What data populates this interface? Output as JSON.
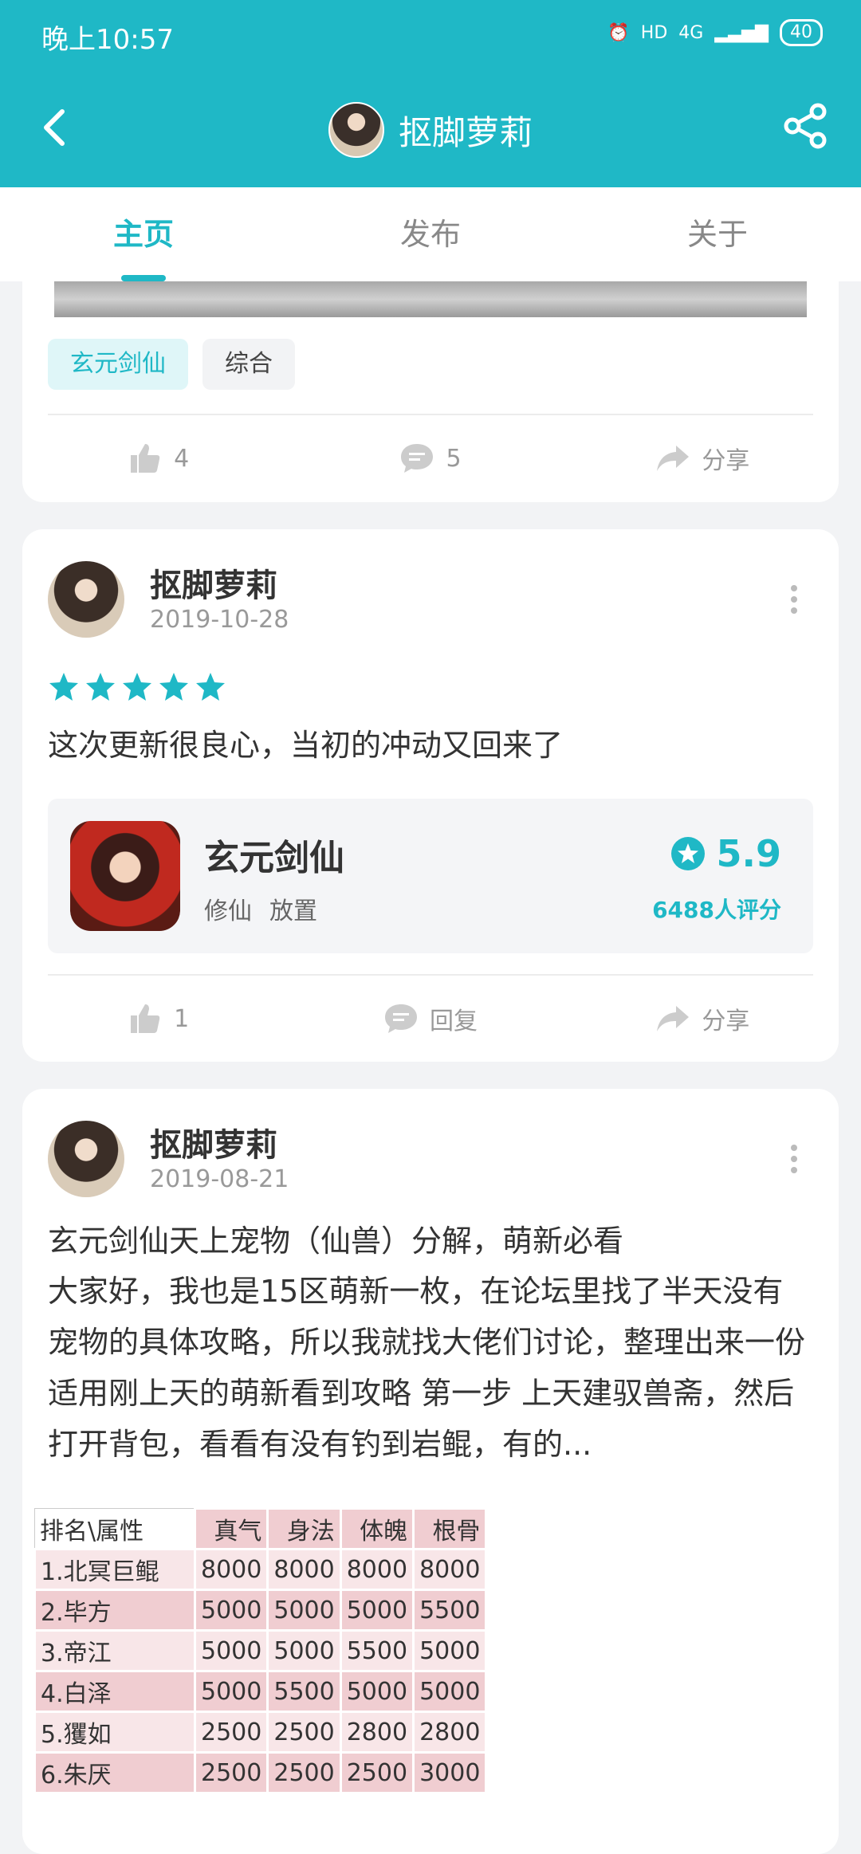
{
  "status": {
    "time": "晚上10:57",
    "hd": "HD",
    "network": "4G",
    "battery": "40"
  },
  "header": {
    "title": "抠脚萝莉"
  },
  "tabs": [
    {
      "label": "主页"
    },
    {
      "label": "发布"
    },
    {
      "label": "关于"
    }
  ],
  "card1": {
    "tags": [
      "玄元剑仙",
      "综合"
    ],
    "likes": "4",
    "comments": "5",
    "share": "分享"
  },
  "post1": {
    "user": "抠脚萝莉",
    "date": "2019-10-28",
    "rating_stars": 5,
    "text": "这次更新很良心，当初的冲动又回来了",
    "game": {
      "name": "玄元剑仙",
      "categories": [
        "修仙",
        "放置"
      ],
      "score": "5.9",
      "ratings_count": "6488人评分"
    },
    "likes": "1",
    "reply": "回复",
    "share": "分享"
  },
  "post2": {
    "user": "抠脚萝莉",
    "date": "2019-08-21",
    "title": "玄元剑仙天上宠物（仙兽）分解，萌新必看",
    "body": "大家好，我也是15区萌新一枚，在论坛里找了半天没有宠物的具体攻略，所以我就找大佬们讨论，整理出来一份适用刚上天的萌新看到攻略 第一步 上天建驭兽斋，然后打开背包，看看有没有钓到岩鲲，有的...",
    "table": {
      "headers": [
        "排名\\属性",
        "真气",
        "身法",
        "体魄",
        "根骨"
      ],
      "rows": [
        [
          "1.北冥巨鲲",
          "8000",
          "8000",
          "8000",
          "8000"
        ],
        [
          "2.毕方",
          "5000",
          "5000",
          "5000",
          "5500"
        ],
        [
          "3.帝江",
          "5000",
          "5000",
          "5500",
          "5000"
        ],
        [
          "4.白泽",
          "5000",
          "5500",
          "5000",
          "5000"
        ],
        [
          "5.玃如",
          "2500",
          "2500",
          "2800",
          "2800"
        ],
        [
          "6.朱厌",
          "2500",
          "2500",
          "2500",
          "3000"
        ]
      ]
    }
  },
  "colors": {
    "accent": "#1fb8c6"
  },
  "icons": {
    "back": "chevron-left-icon",
    "share": "share-icon",
    "like": "thumbs-up-icon",
    "comment": "comment-icon",
    "forward": "forward-icon",
    "star": "star-icon"
  }
}
